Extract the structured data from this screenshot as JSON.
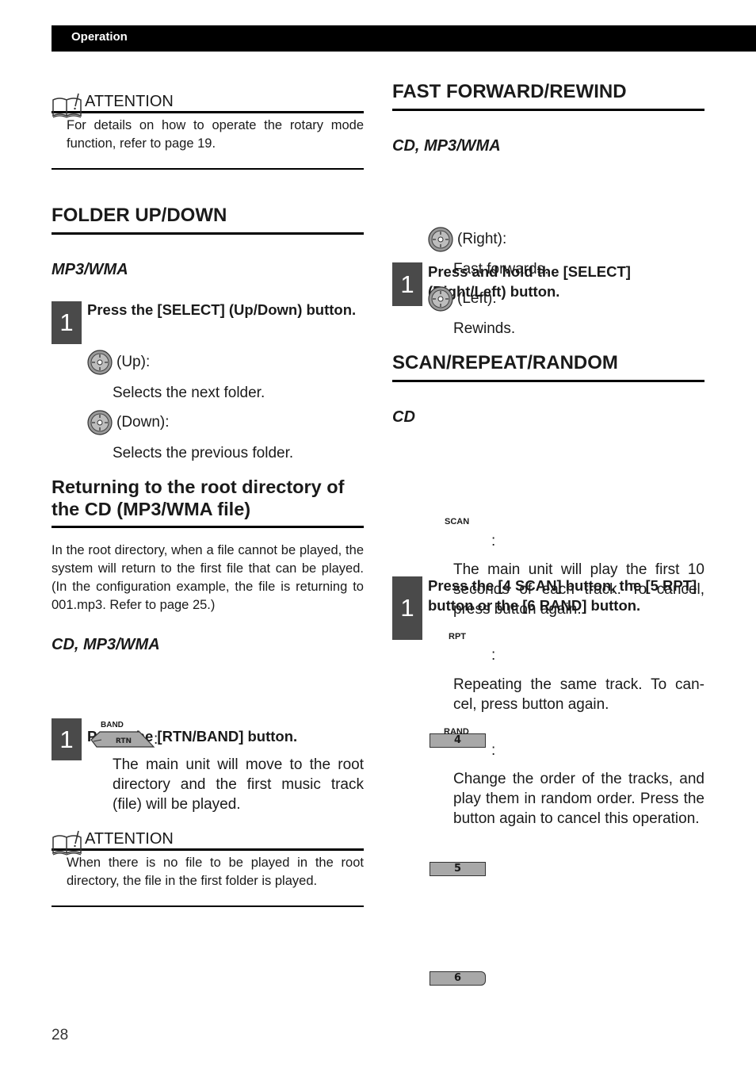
{
  "header": {
    "section": "Operation"
  },
  "left": {
    "attention1": {
      "title": "ATTENTION",
      "text": "For details on how to operate the rotary mode function, refer to page 19."
    },
    "folder": {
      "title": "FOLDER UP/DOWN",
      "subtitle": "MP3/WMA",
      "step_number": "1",
      "step_text": "Press the [SELECT] (Up/Down) button.",
      "items": [
        {
          "icon": "select-dial-icon",
          "label": "(Up):",
          "desc": "Selects the next folder."
        },
        {
          "icon": "select-dial-icon",
          "label": "(Down):",
          "desc": "Selects the previous folder."
        }
      ]
    },
    "root": {
      "title": "Returning to the root directory of the CD (MP3/WMA file)",
      "paragraph": "In the root directory, when a file cannot be played, the system will return to the first file that can be played. (In the configuration example, the file is returning to 001.mp3. Refer to page 25.)",
      "subtitle": "CD, MP3/WMA",
      "step_number": "1",
      "step_text": "Press the [RTN/BAND] button.",
      "key_top_label": "BAND",
      "key_label": "RTN",
      "colon": ":",
      "desc": "The main unit will move to the root directory and the first music track (file) will be played."
    },
    "attention2": {
      "title": "ATTENTION",
      "text": "When there is no file to be played in the root directory, the file in the first folder is played."
    }
  },
  "right": {
    "ffrew": {
      "title": "FAST FORWARD/REWIND",
      "subtitle": "CD, MP3/WMA",
      "step_number": "1",
      "step_text": "Press and hold the [SELECT] (Right/Left) button.",
      "items": [
        {
          "icon": "select-dial-icon",
          "label": "(Right):",
          "desc": "Fast forwards."
        },
        {
          "icon": "select-dial-icon",
          "label": "(Left):",
          "desc": "Rewinds."
        }
      ]
    },
    "scan": {
      "title": "SCAN/REPEAT/RANDOM",
      "subtitle": "CD",
      "step_number": "1",
      "step_text": "Press the [4 SCAN] button, the [5 RPT] button or the [6 RAND] button.",
      "keys": [
        {
          "top_label": "SCAN",
          "key": "4",
          "colon": ":",
          "desc": "The main unit will play the first 10 seconds of each track. To cancel, press button again."
        },
        {
          "top_label": "RPT",
          "key": "5",
          "colon": ":",
          "desc": "Repeating the same track. To can-cel, press button again."
        },
        {
          "top_label": "RAND",
          "key": "6",
          "colon": ":",
          "desc": "Change the order of the tracks, and play them in random order. Press the button again to cancel this operation."
        }
      ]
    }
  },
  "footer": {
    "page_number": "28"
  }
}
